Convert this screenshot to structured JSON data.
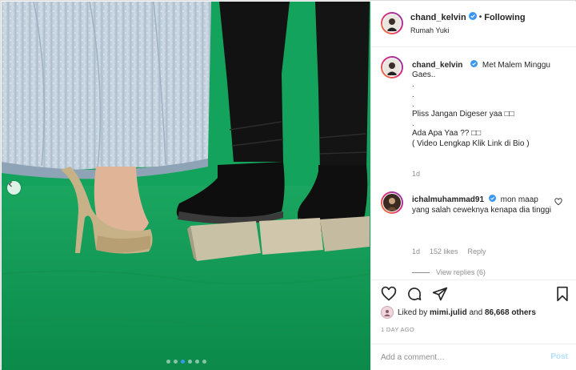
{
  "post": {
    "username": "chand_kelvin",
    "follow_status": "Following",
    "separator": "•",
    "location": "Rumah Yuki"
  },
  "caption": {
    "username": "chand_kelvin",
    "lines": [
      "Met Malem Minggu",
      "Gaes..",
      ".",
      ".",
      ".",
      "Pliss Jangan Digeser yaa □□",
      ".",
      "Ada Apa Yaa ?? □□",
      "( Video Lengkap Klik Link di Bio )"
    ],
    "time": "1d"
  },
  "comment": {
    "username": "ichalmuhammad91",
    "text_first": "mon maap",
    "text_rest": "yang salah ceweknya kenapa dia tinggi",
    "time": "1d",
    "likes": "152 likes",
    "reply": "Reply",
    "view_replies": "View replies (6)"
  },
  "likes": {
    "prefix": "Liked by",
    "user": "mimi.julid",
    "and": "and",
    "count": "86,668 others"
  },
  "date": "1 DAY AGO",
  "add_comment": {
    "placeholder": "Add a comment…",
    "post": "Post"
  },
  "carousel": {
    "slides": 6,
    "active_index": 2
  },
  "colors": {
    "accent": "#3897f0",
    "green_screen": "#0d9b52",
    "post_disabled": "#b2dffc",
    "muted": "#8e8e8e"
  },
  "icons": [
    "chevron-left-icon",
    "verified-icon",
    "heart-icon",
    "comment-icon",
    "share-icon",
    "bookmark-icon"
  ]
}
